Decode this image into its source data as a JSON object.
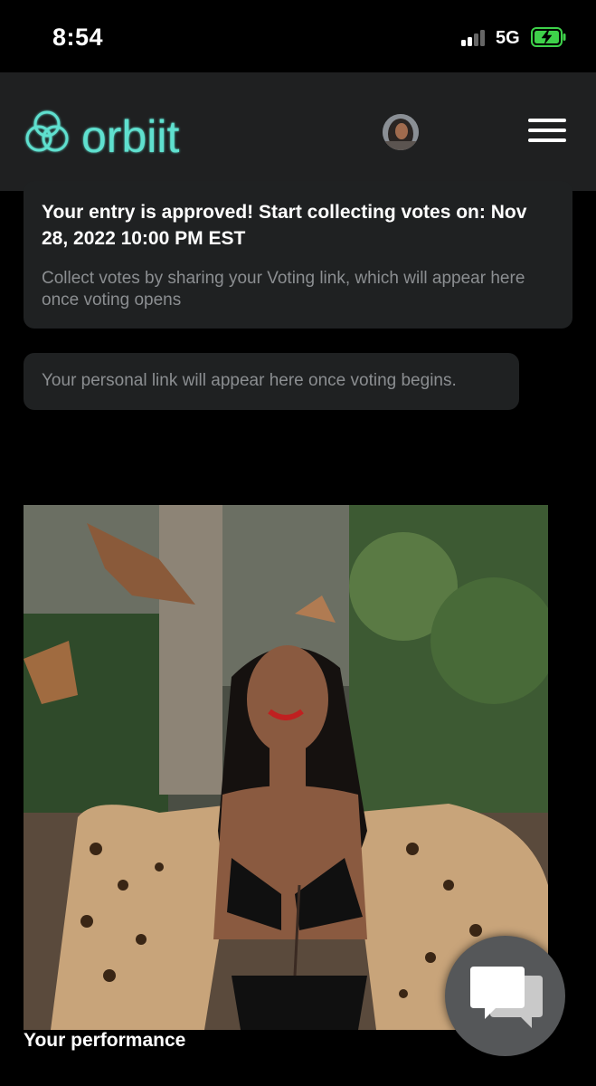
{
  "status_bar": {
    "time": "8:54",
    "network": "5G",
    "battery_icon": "battery-charging-icon",
    "signal_icon": "cellular-signal-icon"
  },
  "header": {
    "logo_text": "orbiit",
    "logo_color": "#5fe0cf",
    "avatar_icon": "user-avatar",
    "menu_icon": "hamburger-menu-icon"
  },
  "notice": {
    "title": "Your entry is approved! Start collecting votes on: Nov 28, 2022 10:00 PM EST",
    "body": "Collect votes by sharing your Voting link, which will appear here once voting opens"
  },
  "voting_link": {
    "placeholder_text": "Your personal link will appear here once voting begins."
  },
  "performance": {
    "caption": "Your performance"
  },
  "chat": {
    "icon": "chat-bubbles-icon"
  }
}
